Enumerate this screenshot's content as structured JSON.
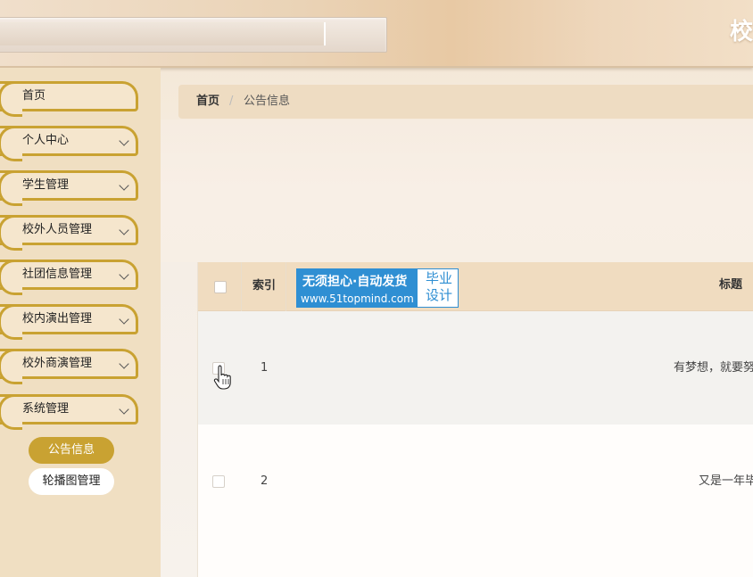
{
  "header": {
    "title": "校"
  },
  "sidebar": {
    "items": [
      {
        "label": "首页",
        "has_arrow": false
      },
      {
        "label": "个人中心",
        "has_arrow": true
      },
      {
        "label": "学生管理",
        "has_arrow": true
      },
      {
        "label": "校外人员管理",
        "has_arrow": true
      },
      {
        "label": "社团信息管理",
        "has_arrow": true
      },
      {
        "label": "校内演出管理",
        "has_arrow": true
      },
      {
        "label": "校外商演管理",
        "has_arrow": true
      },
      {
        "label": "系统管理",
        "has_arrow": true
      }
    ],
    "sub_items": [
      {
        "label": "公告信息",
        "active": true
      },
      {
        "label": "轮播图管理",
        "active": false
      }
    ]
  },
  "breadcrumb": {
    "home": "首页",
    "separator": "/",
    "current": "公告信息"
  },
  "table": {
    "columns": [
      "索引",
      "标题"
    ],
    "rows": [
      {
        "index": "1",
        "title": "有梦想，就要努"
      },
      {
        "index": "2",
        "title": "又是一年毕"
      }
    ]
  },
  "watermark": {
    "line1": "无须担心·自动发货",
    "line2": "www.51topmind.com",
    "right_top": "毕业",
    "right_bottom": "设计"
  },
  "colors": {
    "accent": "#c9a232",
    "sidebar_bg": "#f0dfc2",
    "table_header_bg": "#f0dcc0",
    "watermark_blue": "#2f8fd3"
  }
}
